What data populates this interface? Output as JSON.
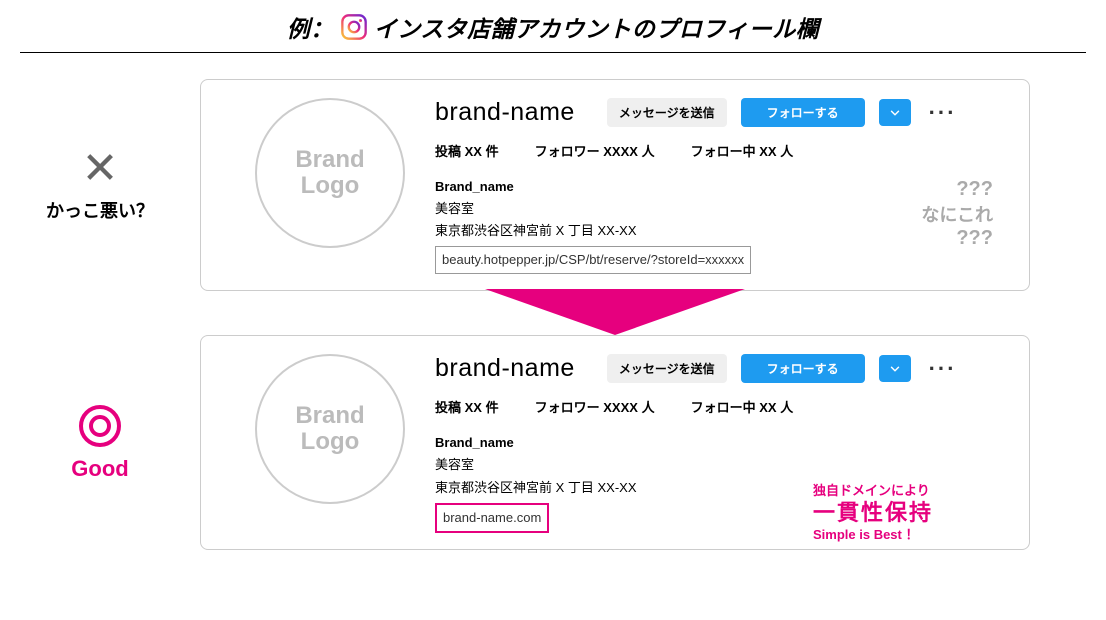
{
  "title": {
    "prefix": "例：",
    "text": "インスタ店舗アカウントのプロフィール欄"
  },
  "bad": {
    "mark": "✕",
    "caption": "かっこ悪い？",
    "annotation": {
      "q1": "???",
      "line": "なにこれ",
      "q2": "???"
    }
  },
  "good": {
    "caption": "Good",
    "annotation": {
      "l1": "独自ドメインにより",
      "l2": "一貫性保持",
      "l3": "Simple is Best ！"
    }
  },
  "profile": {
    "avatar_line1": "Brand",
    "avatar_line2": "Logo",
    "handle": "brand-name",
    "btn_message": "メッセージを送信",
    "btn_follow": "フォローする",
    "dots": "···",
    "stats": {
      "posts_label": "投稿",
      "posts_value": "XX",
      "posts_unit": "件",
      "followers_label": "フォロワー",
      "followers_value": "XXXX",
      "followers_unit": "人",
      "following_label": "フォロー中",
      "following_value": "XX",
      "following_unit": "人"
    },
    "bio": {
      "name": "Brand_name",
      "category": "美容室",
      "address": "東京都渋谷区神宮前 X 丁目 XX-XX"
    },
    "link_bad": "beauty.hotpepper.jp/CSP/bt/reserve/?storeId=xxxxxx",
    "link_good": "brand-name.com"
  }
}
